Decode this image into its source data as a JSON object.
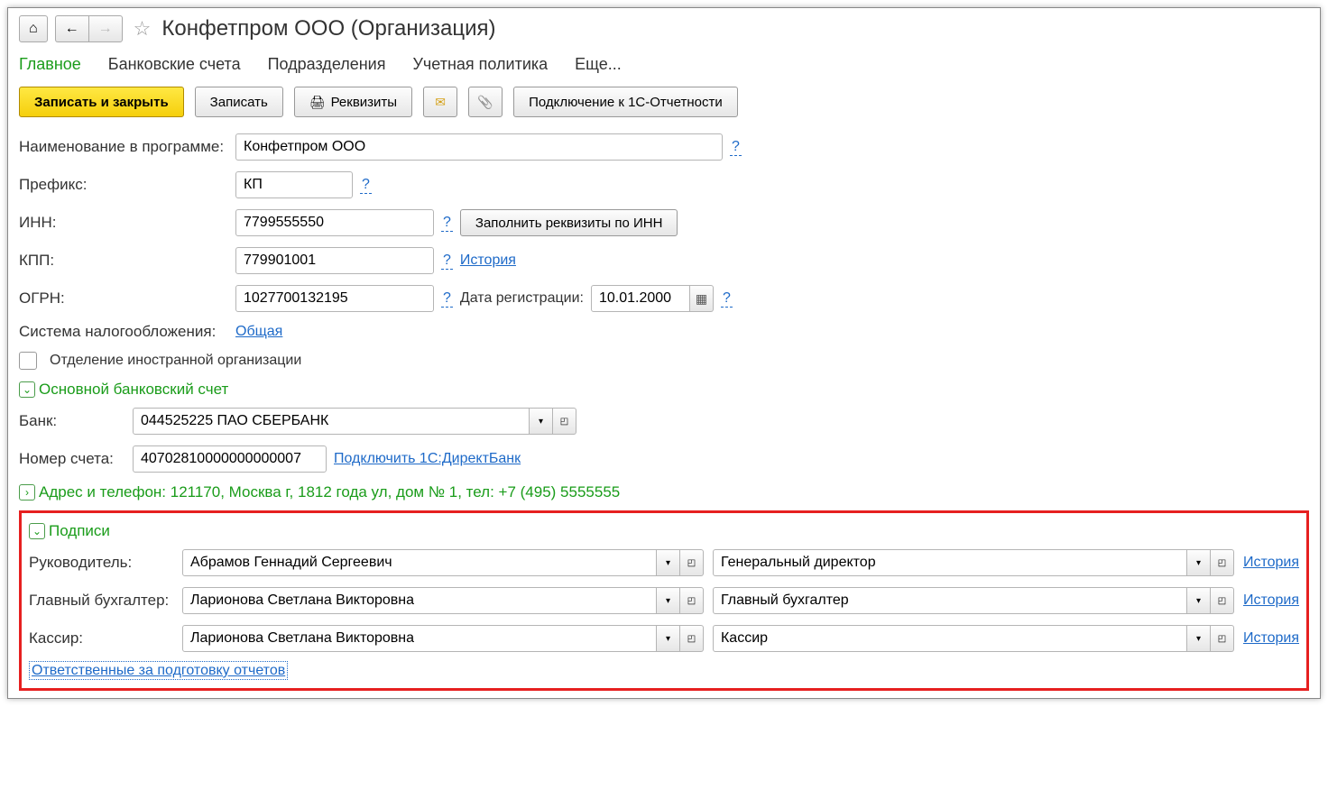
{
  "title": "Конфетпром ООО (Организация)",
  "tabs": {
    "main": "Главное",
    "bank_accounts": "Банковские счета",
    "divisions": "Подразделения",
    "accounting_policy": "Учетная политика",
    "more": "Еще..."
  },
  "toolbar": {
    "save_close": "Записать и закрыть",
    "save": "Записать",
    "details": "Реквизиты",
    "connect_1c": "Подключение к 1С-Отчетности"
  },
  "labels": {
    "name_in_program": "Наименование в программе:",
    "prefix": "Префикс:",
    "inn": "ИНН:",
    "kpp": "КПП:",
    "ogrn": "ОГРН:",
    "tax_system": "Система налогообложения:",
    "foreign_branch": "Отделение иностранной организации",
    "main_bank_account": "Основной банковский счет",
    "bank": "Банк:",
    "account_number": "Номер счета:",
    "reg_date": "Дата регистрации:",
    "address_phone": "Адрес и телефон: 121170, Москва г, 1812 года ул, дом № 1, тел: +7 (495) 5555555",
    "history": "История",
    "signatures": "Подписи",
    "head": "Руководитель:",
    "chief_accountant": "Главный бухгалтер:",
    "cashier": "Кассир:",
    "reports_responsible": "Ответственные за подготовку отчетов",
    "connect_directbank": "Подключить 1С:ДиректБанк",
    "fill_by_inn": "Заполнить реквизиты по ИНН",
    "tax_system_value": "Общая"
  },
  "values": {
    "name": "Конфетпром ООО",
    "prefix": "КП",
    "inn": "7799555550",
    "kpp": "779901001",
    "ogrn": "1027700132195",
    "reg_date": "10.01.2000",
    "bank": "044525225 ПАО СБЕРБАНК",
    "account": "40702810000000000007",
    "head_person": "Абрамов Геннадий Сергеевич",
    "head_position": "Генеральный директор",
    "accountant_person": "Ларионова Светлана Викторовна",
    "accountant_position": "Главный бухгалтер",
    "cashier_person": "Ларионова Светлана Викторовна",
    "cashier_position": "Кассир"
  }
}
